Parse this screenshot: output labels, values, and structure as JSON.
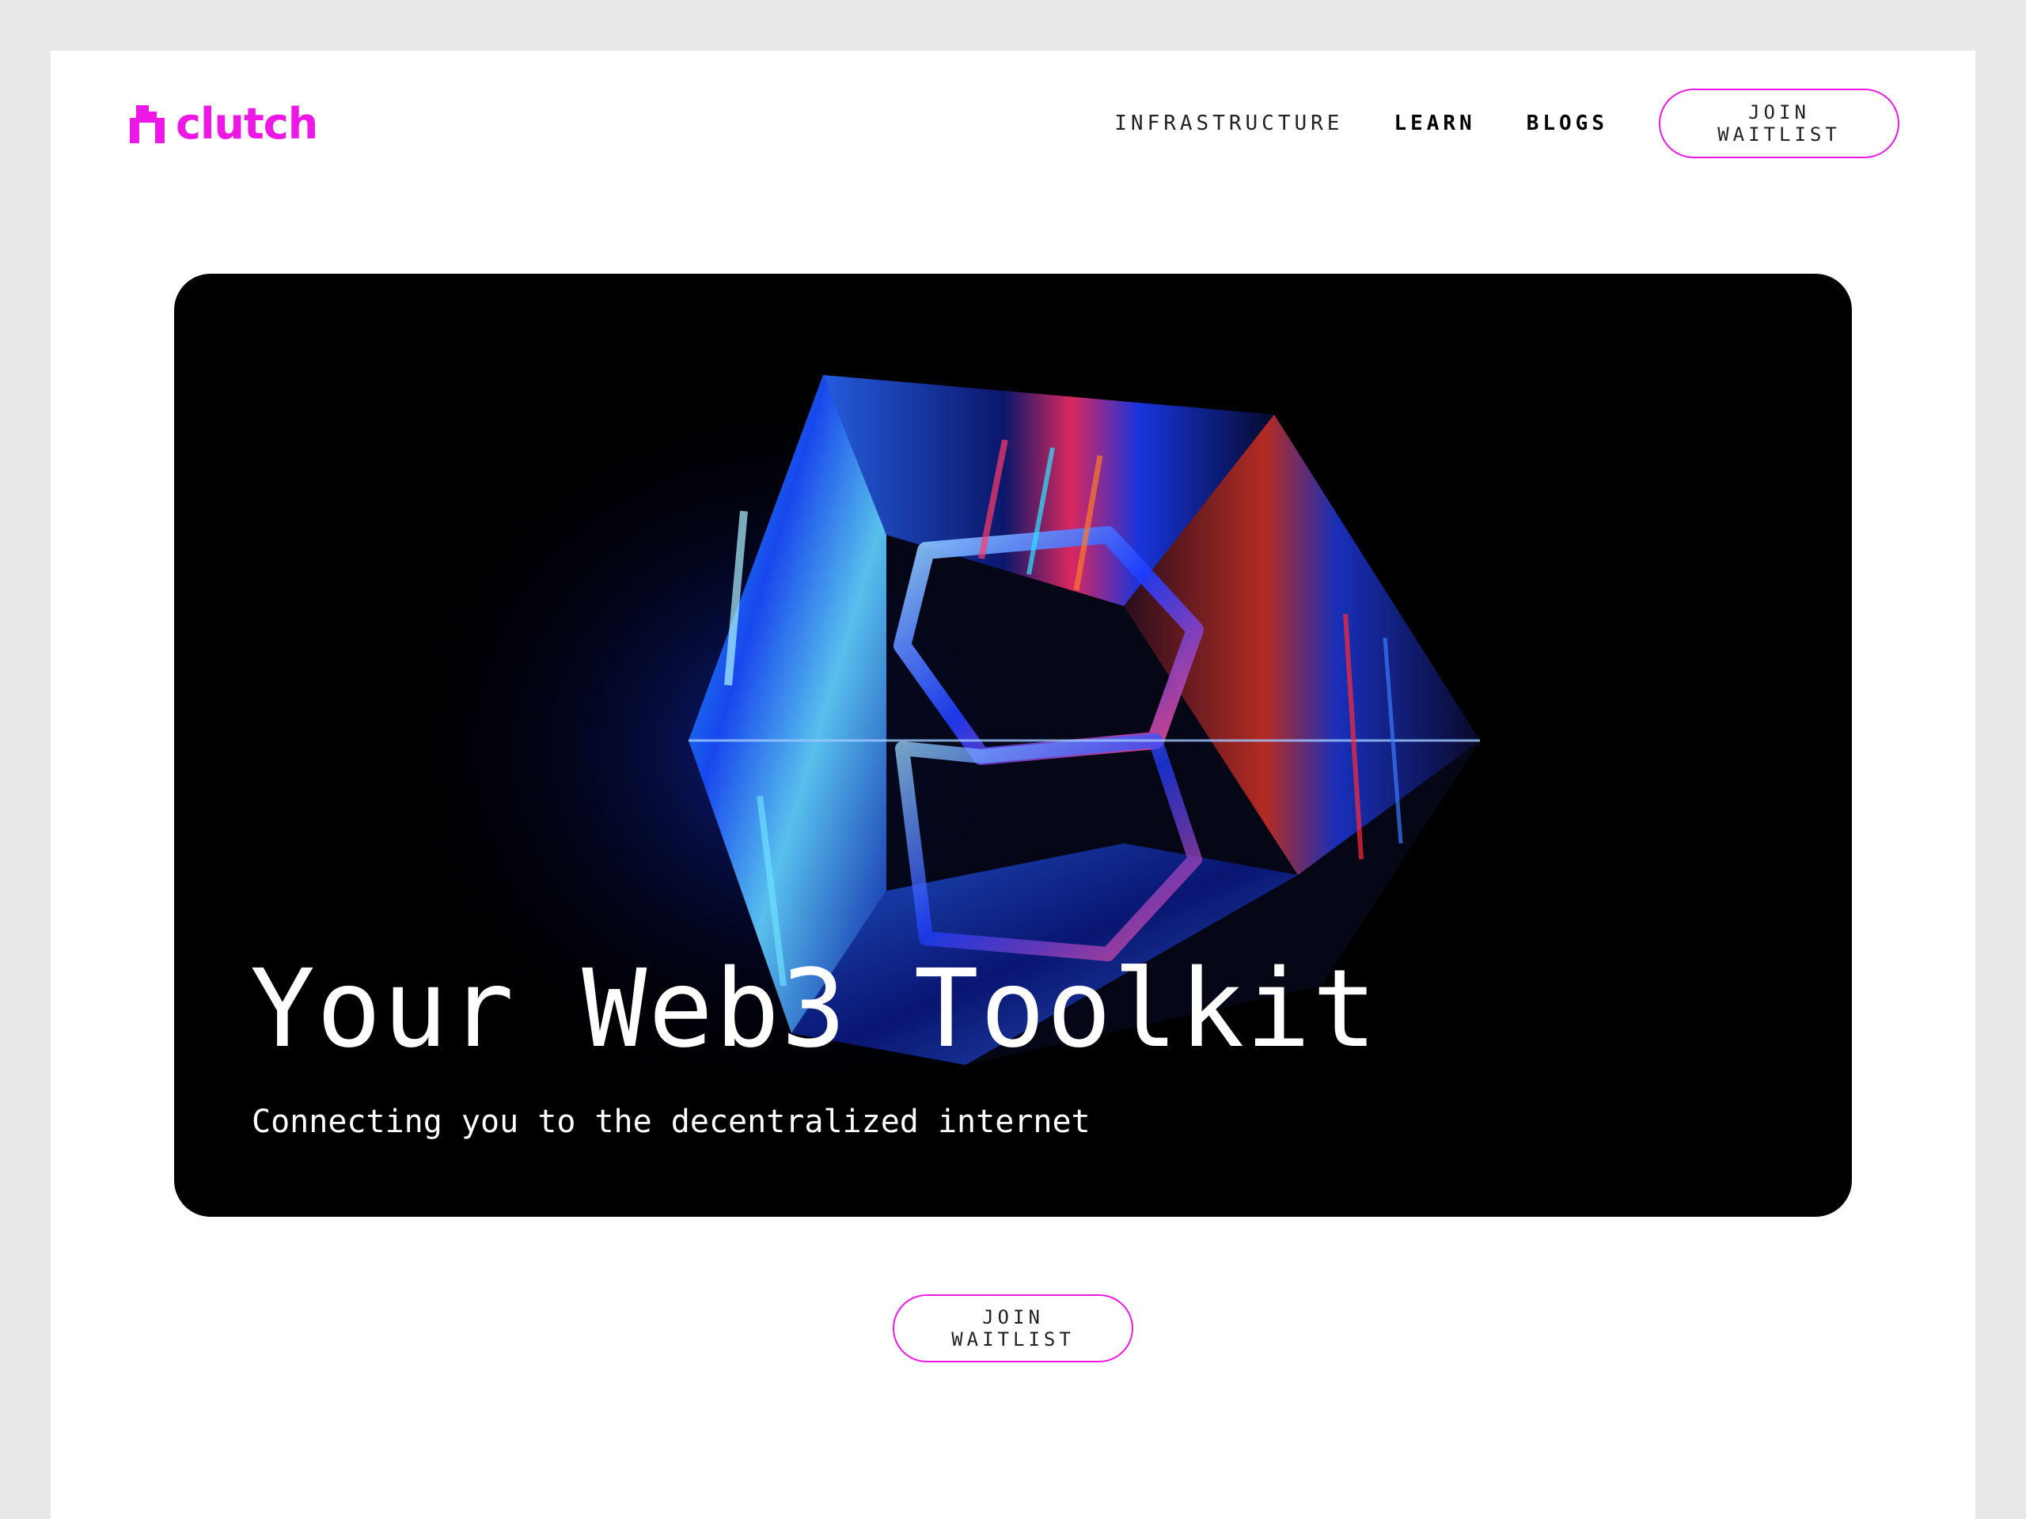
{
  "brand": {
    "name": "clutch",
    "accent_color": "#ee18e6",
    "logo_icon": "clutch-logo-icon"
  },
  "nav": {
    "items": [
      {
        "label": "INFRASTRUCTURE"
      },
      {
        "label": "LEARN"
      },
      {
        "label": "BLOGS"
      }
    ],
    "cta_label": "JOIN WAITLIST"
  },
  "hero": {
    "title": "Your Web3 Toolkit",
    "subtitle": "Connecting you to the decentralized internet",
    "image": "holographic-glass-cube"
  },
  "cta": {
    "label": "JOIN WAITLIST"
  }
}
